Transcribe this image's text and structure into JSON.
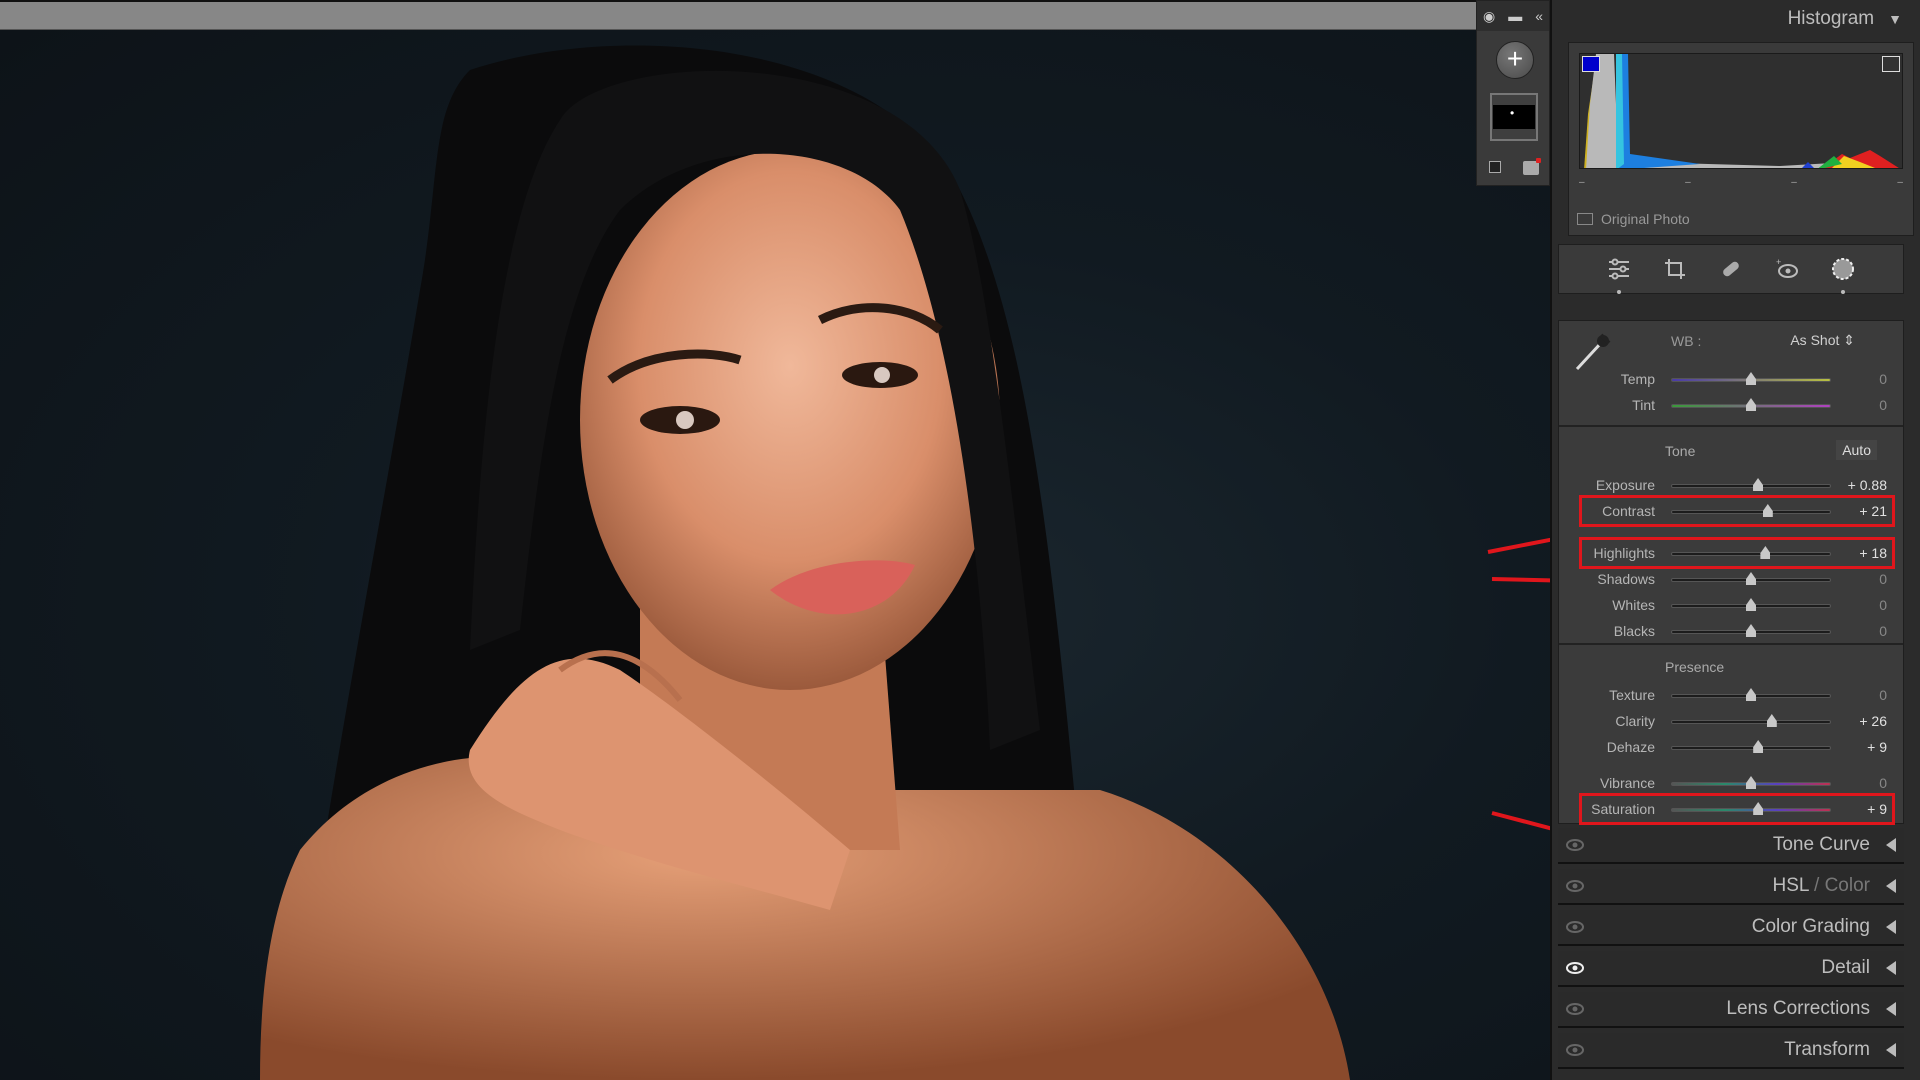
{
  "navigator": {
    "eye_icon": "eye-icon",
    "collapse_icon": "double-chevron-left-icon",
    "add_label": "+"
  },
  "histogram": {
    "title": "Histogram",
    "original_photo_label": "Original Photo",
    "original_photo_checked": false
  },
  "tools": [
    "edit-sliders",
    "crop",
    "healing",
    "red-eye",
    "masking"
  ],
  "basic": {
    "wb_label": "WB :",
    "wb_value": "As Shot",
    "wb_sliders": [
      {
        "label": "Temp",
        "value": "0",
        "pos": 0.5
      },
      {
        "label": "Tint",
        "value": "0",
        "pos": 0.5
      }
    ],
    "tone_title": "Tone",
    "auto_label": "Auto",
    "tone_sliders": [
      {
        "label": "Exposure",
        "value": "+ 0.88",
        "pos": 0.544,
        "highlighted": false
      },
      {
        "label": "Contrast",
        "value": "+ 21",
        "pos": 0.605,
        "highlighted": true
      },
      {
        "label": "Highlights",
        "value": "+ 18",
        "pos": 0.59,
        "highlighted": true
      },
      {
        "label": "Shadows",
        "value": "0",
        "pos": 0.5,
        "highlighted": false
      },
      {
        "label": "Whites",
        "value": "0",
        "pos": 0.5,
        "highlighted": false
      },
      {
        "label": "Blacks",
        "value": "0",
        "pos": 0.5,
        "highlighted": false
      }
    ],
    "presence_title": "Presence",
    "presence_sliders": [
      {
        "label": "Texture",
        "value": "0",
        "pos": 0.5,
        "highlighted": false
      },
      {
        "label": "Clarity",
        "value": "+ 26",
        "pos": 0.63,
        "highlighted": false
      },
      {
        "label": "Dehaze",
        "value": "+ 9",
        "pos": 0.545,
        "highlighted": false
      },
      {
        "label": "Vibrance",
        "value": "0",
        "pos": 0.5,
        "highlighted": false
      },
      {
        "label": "Saturation",
        "value": "+ 9",
        "pos": 0.545,
        "highlighted": true
      }
    ]
  },
  "panels": [
    {
      "title": "Tone Curve",
      "suffix": "",
      "eye_active": false
    },
    {
      "title": "HSL",
      "suffix": " / Color",
      "eye_active": false
    },
    {
      "title": "Color Grading",
      "suffix": "",
      "eye_active": false
    },
    {
      "title": "Detail",
      "suffix": "",
      "eye_active": true
    },
    {
      "title": "Lens Corrections",
      "suffix": "",
      "eye_active": false
    },
    {
      "title": "Transform",
      "suffix": "",
      "eye_active": false
    }
  ],
  "annotations": {
    "color": "#e0161c",
    "highlighted": [
      "Contrast",
      "Highlights",
      "Saturation"
    ]
  }
}
